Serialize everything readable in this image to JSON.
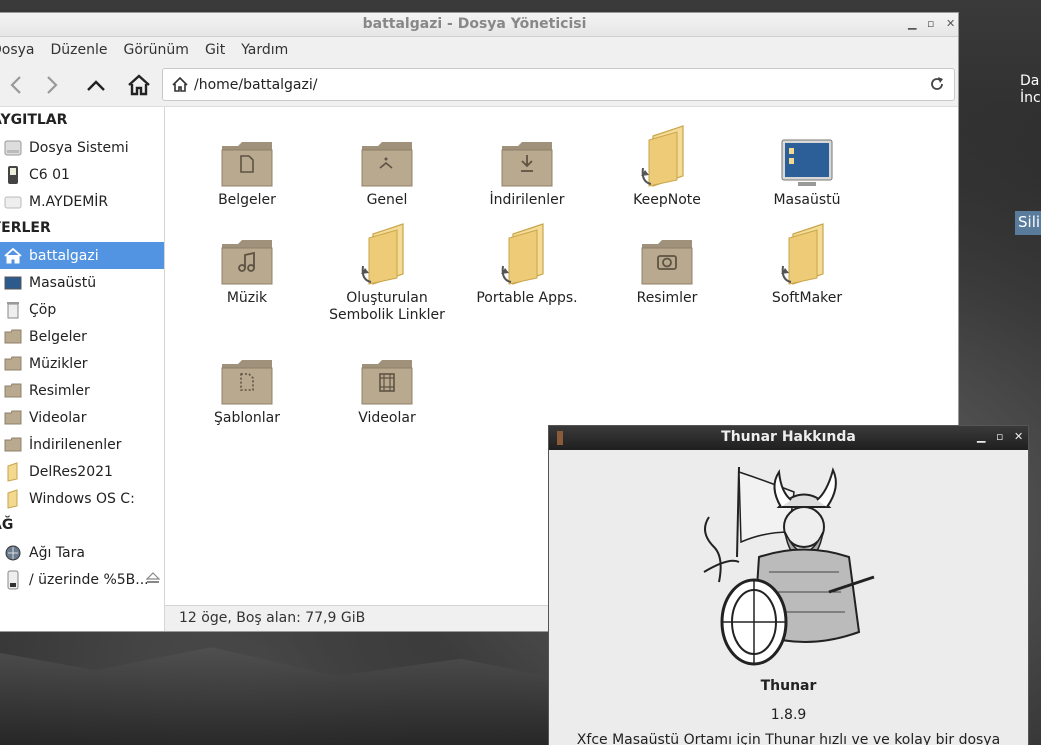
{
  "file_manager": {
    "title": "battalgazi - Dosya Yöneticisi",
    "menu": [
      "Dosya",
      "Düzenle",
      "Görünüm",
      "Git",
      "Yardım"
    ],
    "address": "/home/battalgazi/",
    "sidebar": {
      "devices_header": "AYGITLAR",
      "devices": [
        "Dosya Sistemi",
        "C6 01",
        "M.AYDEMİR"
      ],
      "places_header": "YERLER",
      "places": [
        "battalgazi",
        "Masaüstü",
        "Çöp",
        "Belgeler",
        "Müzikler",
        "Resimler",
        "Videolar",
        "İndirilenenler",
        "DelRes2021",
        "Windows OS C:"
      ],
      "network_header": "AĞ",
      "network": [
        "Ağı Tara",
        "/ üzerinde %5B..."
      ]
    },
    "items": [
      {
        "name": "Belgeler",
        "icon": "documents-folder-icon"
      },
      {
        "name": "Genel",
        "icon": "public-folder-icon"
      },
      {
        "name": "İndirilenler",
        "icon": "downloads-folder-icon"
      },
      {
        "name": "KeepNote",
        "icon": "folder-link-icon"
      },
      {
        "name": "Masaüstü",
        "icon": "desktop-icon"
      },
      {
        "name": "Müzik",
        "icon": "music-folder-icon"
      },
      {
        "name": "Oluşturulan Sembolik Linkler",
        "icon": "folder-link-icon"
      },
      {
        "name": "Portable Apps.",
        "icon": "folder-link-icon"
      },
      {
        "name": "Resimler",
        "icon": "pictures-folder-icon"
      },
      {
        "name": "SoftMaker",
        "icon": "folder-link-icon"
      },
      {
        "name": "Şablonlar",
        "icon": "templates-folder-icon"
      },
      {
        "name": "Videolar",
        "icon": "videos-folder-icon"
      }
    ],
    "status": "12 öge, Boş alan: 77,9 GiB"
  },
  "about": {
    "title": "Thunar Hakkında",
    "name": "Thunar",
    "version": "1.8.9",
    "description": "Xfce Masaüstü Ortamı için Thunar hızlı ve ve kolay bir dosya"
  },
  "desktop": {
    "text_line1": "Da",
    "text_line2": "İnc",
    "selected_label": "Sili"
  },
  "colors": {
    "selection": "#5294e2",
    "folder": "#b8a98f"
  }
}
